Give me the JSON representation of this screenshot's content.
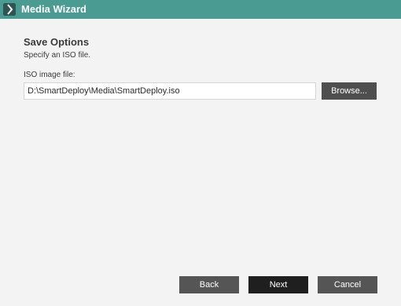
{
  "window": {
    "title": "Media Wizard",
    "icon": "chevron-right-icon",
    "titlebar_color": "#4a9c93"
  },
  "section": {
    "heading": "Save Options",
    "subheading": "Specify an ISO file."
  },
  "iso_field": {
    "label": "ISO image file:",
    "value": "D:\\SmartDeploy\\Media\\SmartDeploy.iso",
    "browse_label": "Browse..."
  },
  "footer": {
    "back_label": "Back",
    "next_label": "Next",
    "cancel_label": "Cancel"
  }
}
